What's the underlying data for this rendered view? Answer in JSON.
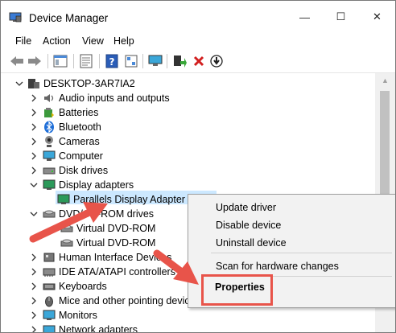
{
  "title": "Device Manager",
  "window_controls": {
    "minimize": "—",
    "maximize": "☐",
    "close": "✕"
  },
  "menu": [
    "File",
    "Action",
    "View",
    "Help"
  ],
  "tree": {
    "root": "DESKTOP-3AR7IA2",
    "items": [
      {
        "label": "Audio inputs and outputs",
        "icon": "speaker-icon"
      },
      {
        "label": "Batteries",
        "icon": "battery-icon"
      },
      {
        "label": "Bluetooth",
        "icon": "bluetooth-icon"
      },
      {
        "label": "Cameras",
        "icon": "camera-icon"
      },
      {
        "label": "Computer",
        "icon": "computer-icon"
      },
      {
        "label": "Disk drives",
        "icon": "disk-drive-icon"
      },
      {
        "label": "Display adapters",
        "icon": "display-adapter-icon",
        "expanded": true
      },
      {
        "label": "Parallels Display Adapter (W",
        "icon": "display-adapter-icon",
        "child": true,
        "selected": true
      },
      {
        "label": "DVD/CD-ROM drives",
        "icon": "dvd-icon",
        "expanded": true
      },
      {
        "label": "Virtual DVD-ROM",
        "icon": "dvd-icon",
        "child": true
      },
      {
        "label": "Virtual DVD-ROM",
        "icon": "dvd-icon",
        "child": true
      },
      {
        "label": "Human Interface Devices",
        "icon": "hid-icon"
      },
      {
        "label": "IDE ATA/ATAPI controllers",
        "icon": "ide-controller-icon"
      },
      {
        "label": "Keyboards",
        "icon": "keyboard-icon"
      },
      {
        "label": "Mice and other pointing devices",
        "icon": "mouse-icon"
      },
      {
        "label": "Monitors",
        "icon": "monitor-icon"
      },
      {
        "label": "Network adapters",
        "icon": "network-adapter-icon"
      }
    ]
  },
  "context_menu": {
    "update": "Update driver",
    "disable": "Disable device",
    "uninstall": "Uninstall device",
    "scan": "Scan for hardware changes",
    "properties": "Properties"
  },
  "colors": {
    "highlight_red": "#e8544a",
    "selection": "#cce8ff"
  }
}
